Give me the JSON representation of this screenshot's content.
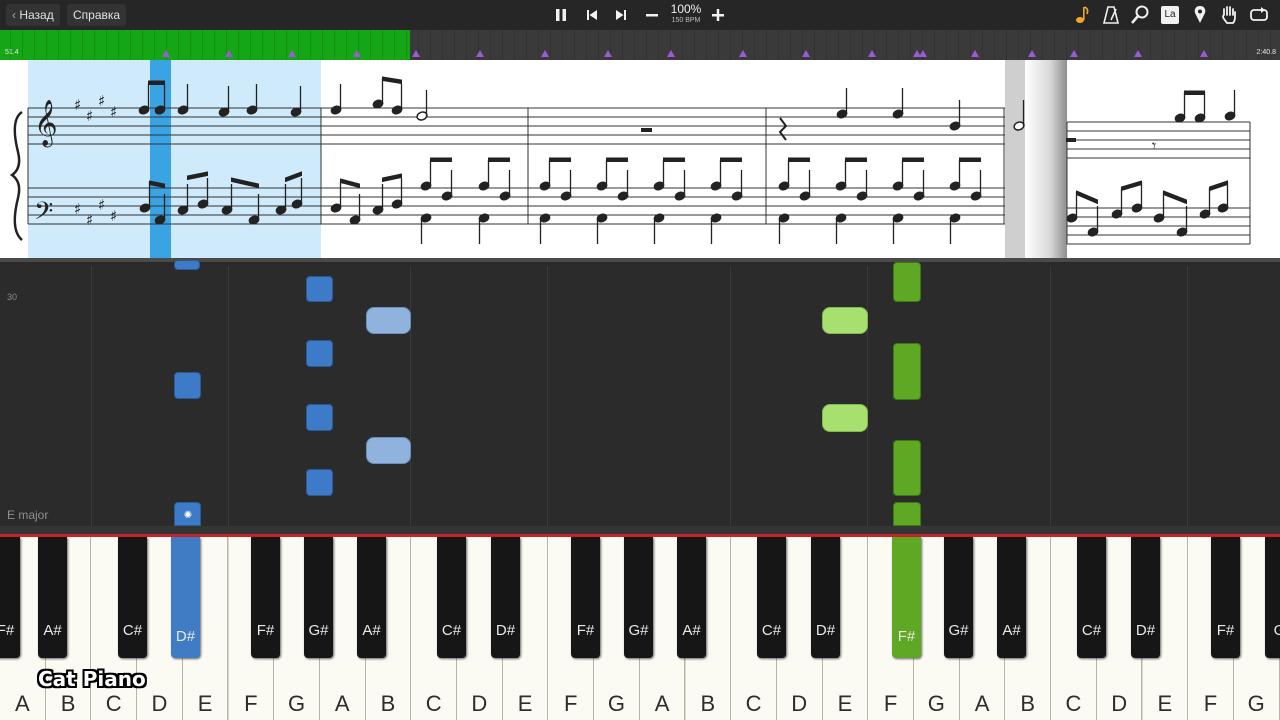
{
  "toolbar": {
    "back_label": "Назад",
    "help_label": "Справка",
    "zoom_percent": "100%",
    "tempo_label": "150 BPM",
    "icons": [
      "pause-icon",
      "skip-back-icon",
      "skip-forward-icon",
      "minus-icon",
      "plus-icon",
      "note-icon",
      "metronome-icon",
      "magnifier-icon",
      "la-icon",
      "location-pin-icon",
      "hand-icon",
      "loop-icon"
    ],
    "la_label": "La"
  },
  "progress": {
    "elapsed": "51.4",
    "total": "2:40.8",
    "fraction": 0.32,
    "fill_color": "#14a614",
    "marker_color": "#9c5bd6"
  },
  "roll": {
    "measure_number": "30",
    "key_signature": "E major"
  },
  "keyboard": {
    "white_keys": [
      "A",
      "B",
      "C",
      "D",
      "E",
      "F",
      "G",
      "A",
      "B",
      "C",
      "D",
      "E",
      "F",
      "G",
      "A",
      "B",
      "C",
      "D",
      "E",
      "F",
      "G",
      "A",
      "B",
      "C",
      "D",
      "E",
      "F",
      "G"
    ],
    "black_keys": [
      "F#",
      "A#",
      "C#",
      "D#",
      "F#",
      "G#",
      "A#",
      "C#",
      "D#",
      "F#",
      "G#",
      "A#",
      "C#",
      "D#",
      "F#",
      "G#",
      "A#",
      "C#",
      "D#",
      "F#",
      "G"
    ],
    "pressed": [
      "D#",
      "F#"
    ],
    "colors": {
      "left_hand": "#3d7bc8",
      "right_hand": "#5ea824",
      "red_line": "#c4262e"
    }
  },
  "brand": {
    "text": "Cat Piano"
  }
}
